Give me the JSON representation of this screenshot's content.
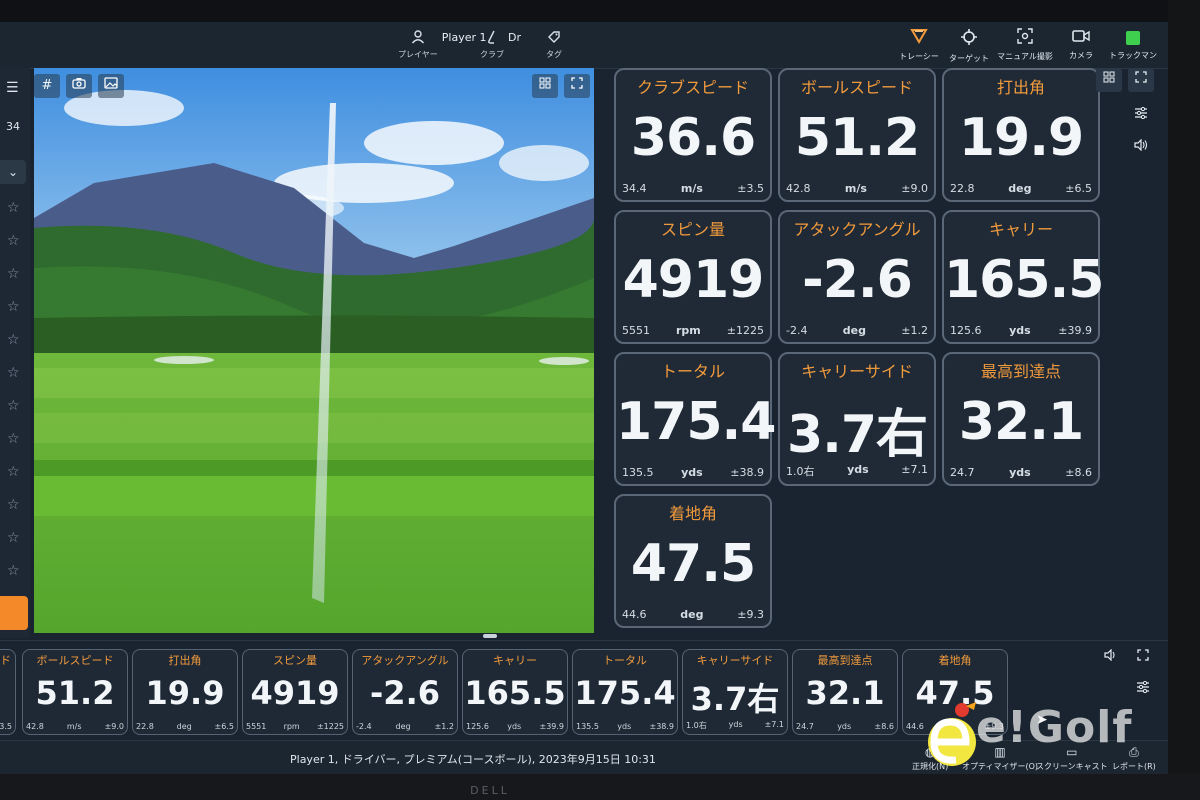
{
  "topbar": {
    "player_label": "プレイヤー",
    "player_value": "Player 1",
    "club_label": "クラブ",
    "club_value": "Dr",
    "tag_label": "タグ",
    "right_items": [
      {
        "label": "トレーシー",
        "icon": "tracer-icon"
      },
      {
        "label": "ターゲット",
        "icon": "target-icon"
      },
      {
        "label": "マニュアル撮影",
        "icon": "manual-capture-icon"
      },
      {
        "label": "カメラ",
        "icon": "camera-icon"
      },
      {
        "label": "トラックマン",
        "icon": "trackman-status-icon",
        "color": "#3ecf4f"
      }
    ]
  },
  "rail": {
    "shot_count": "34"
  },
  "stats": [
    {
      "title": "クラブスピード",
      "value": "36.6",
      "avg": "34.4",
      "unit": "m/s",
      "dev": "±3.5"
    },
    {
      "title": "ボールスピード",
      "value": "51.2",
      "avg": "42.8",
      "unit": "m/s",
      "dev": "±9.0"
    },
    {
      "title": "打出角",
      "value": "19.9",
      "avg": "22.8",
      "unit": "deg",
      "dev": "±6.5"
    },
    {
      "title": "スピン量",
      "value": "4919",
      "avg": "5551",
      "unit": "rpm",
      "dev": "±1225"
    },
    {
      "title": "アタックアングル",
      "value": "-2.6",
      "avg": "-2.4",
      "unit": "deg",
      "dev": "±1.2"
    },
    {
      "title": "キャリー",
      "value": "165.5",
      "avg": "125.6",
      "unit": "yds",
      "dev": "±39.9"
    },
    {
      "title": "トータル",
      "value": "175.4",
      "avg": "135.5",
      "unit": "yds",
      "dev": "±38.9"
    },
    {
      "title": "キャリーサイド",
      "value": "3.7右",
      "avg": "1.0右",
      "unit": "yds",
      "dev": "±7.1"
    },
    {
      "title": "最高到達点",
      "value": "32.1",
      "avg": "24.7",
      "unit": "yds",
      "dev": "±8.6"
    },
    {
      "title": "着地角",
      "value": "47.5",
      "avg": "44.6",
      "unit": "deg",
      "dev": "±9.3"
    }
  ],
  "strip": [
    {
      "title": "ボールスピード",
      "value": "51.2",
      "avg": "42.8",
      "unit": "m/s",
      "dev": "±9.0"
    },
    {
      "title": "打出角",
      "value": "19.9",
      "avg": "22.8",
      "unit": "deg",
      "dev": "±6.5"
    },
    {
      "title": "スピン量",
      "value": "4919",
      "avg": "5551",
      "unit": "rpm",
      "dev": "±1225"
    },
    {
      "title": "アタックアングル",
      "value": "-2.6",
      "avg": "-2.4",
      "unit": "deg",
      "dev": "±1.2"
    },
    {
      "title": "キャリー",
      "value": "165.5",
      "avg": "125.6",
      "unit": "yds",
      "dev": "±39.9"
    },
    {
      "title": "トータル",
      "value": "175.4",
      "avg": "135.5",
      "unit": "yds",
      "dev": "±38.9"
    },
    {
      "title": "キャリーサイド",
      "value": "3.7右",
      "avg": "1.0右",
      "unit": "yds",
      "dev": "±7.1"
    },
    {
      "title": "最高到達点",
      "value": "32.1",
      "avg": "24.7",
      "unit": "yds",
      "dev": "±8.6"
    },
    {
      "title": "着地角",
      "value": "47.5",
      "avg": "44.6",
      "unit": "deg",
      "dev": "±9.3"
    }
  ],
  "strip_partial": {
    "dev": "3.5"
  },
  "status": {
    "text": "Player 1, ドライバー, プレミアム(コースボール), 2023年9月15日 10:31",
    "actions": [
      {
        "label": "正規化(N)",
        "icon": "normalize-icon"
      },
      {
        "label": "オプティマイザー(O)",
        "icon": "optimizer-icon"
      },
      {
        "label": "スクリーンキャスト",
        "icon": "screencast-icon"
      },
      {
        "label": "レポート(R)",
        "icon": "report-icon"
      }
    ]
  },
  "watermark": {
    "text": "e!Golf"
  },
  "monitor_logo": "DELL",
  "colors": {
    "accent": "#f19a3c",
    "card_bg": "#1f2a36",
    "card_border": "#5a6776",
    "status_green": "#3ecf4f"
  }
}
